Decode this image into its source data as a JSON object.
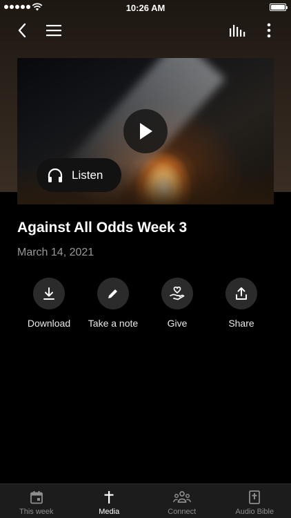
{
  "status": {
    "time": "10:26 AM"
  },
  "hero": {
    "listen_label": "Listen"
  },
  "sermon": {
    "title": "Against All Odds Week 3",
    "date": "March 14, 2021"
  },
  "actions": [
    {
      "label": "Download",
      "icon": "download-icon"
    },
    {
      "label": "Take a note",
      "icon": "pencil-icon"
    },
    {
      "label": "Give",
      "icon": "heart-hand-icon"
    },
    {
      "label": "Share",
      "icon": "share-icon"
    }
  ],
  "tabs": [
    {
      "label": "This week",
      "icon": "calendar-icon",
      "active": false
    },
    {
      "label": "Media",
      "icon": "cross-icon",
      "active": true
    },
    {
      "label": "Connect",
      "icon": "people-icon",
      "active": false
    },
    {
      "label": "Audio Bible",
      "icon": "bible-icon",
      "active": false
    }
  ],
  "colors": {
    "background": "#000000",
    "button_circle": "#2b2b2b",
    "tab_bar": "#1c1c1c",
    "date_text": "#9a9a9a"
  }
}
